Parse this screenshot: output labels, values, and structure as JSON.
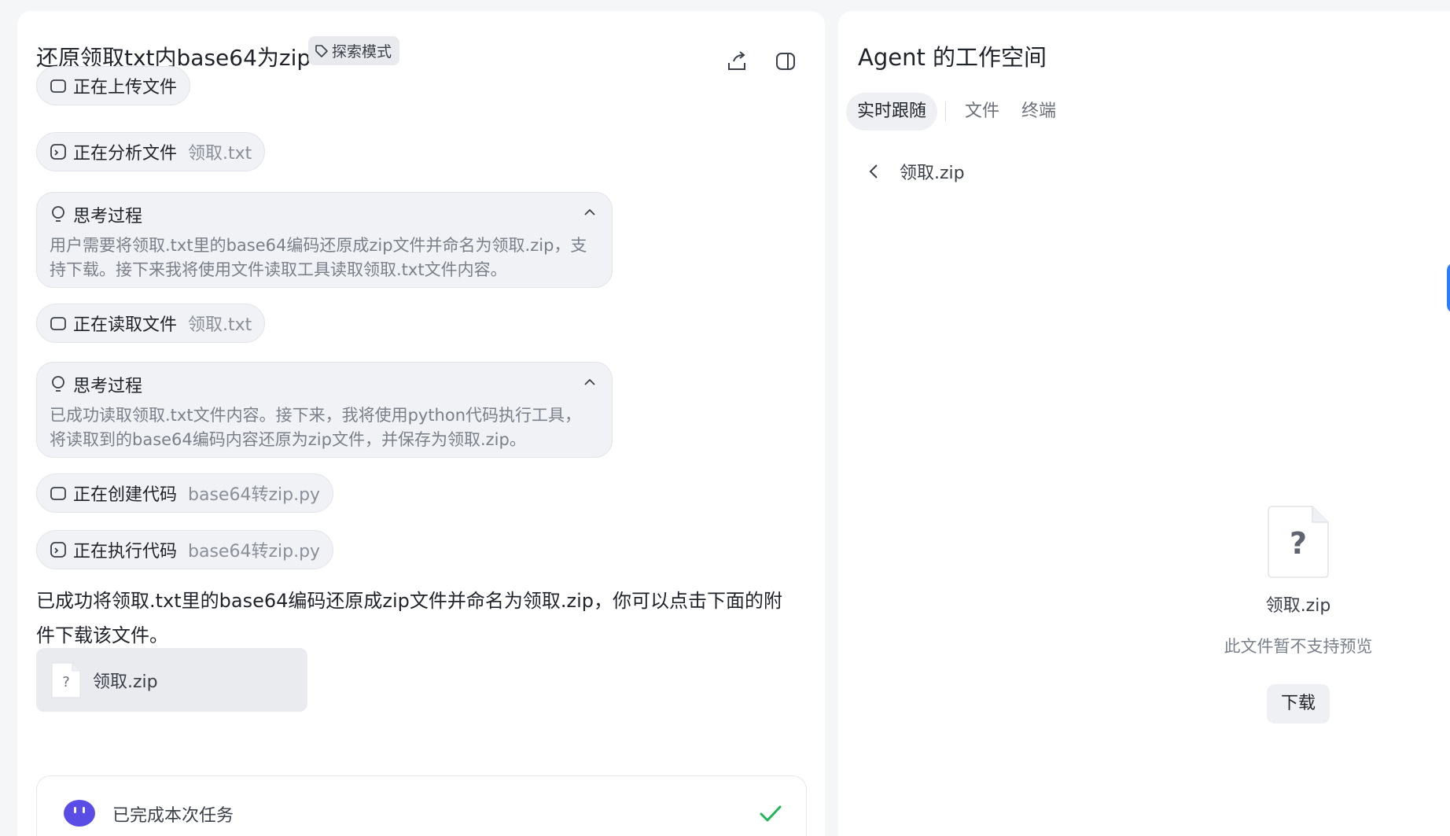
{
  "header": {
    "task_title": "还原领取txt内base64为zip",
    "mode_badge": "探索模式"
  },
  "steps": [
    {
      "action": "正在上传文件",
      "target": ""
    },
    {
      "action": "正在分析文件",
      "target": "领取.txt"
    },
    {
      "action": "正在读取文件",
      "target": "领取.txt"
    },
    {
      "action": "正在创建代码",
      "target": "base64转zip.py"
    },
    {
      "action": "正在执行代码",
      "target": "base64转zip.py"
    }
  ],
  "thoughts": [
    {
      "title": "思考过程",
      "text": "用户需要将领取.txt里的base64编码还原成zip文件并命名为领取.zip，支持下载。接下来我将使用文件读取工具读取领取.txt文件内容。"
    },
    {
      "title": "思考过程",
      "text": "已成功读取领取.txt文件内容。接下来，我将使用python代码执行工具，将读取到的base64编码内容还原为zip文件，并保存为领取.zip。"
    }
  ],
  "answer": "已成功将领取.txt里的base64编码还原成zip文件并命名为领取.zip，你可以点击下面的附件下载该文件。",
  "attachment": {
    "name": "领取.zip",
    "icon": "unknown-file-icon"
  },
  "status": {
    "text": "已完成本次任务"
  },
  "workspace": {
    "title": "Agent 的工作空间",
    "tabs": [
      "实时跟随",
      "文件",
      "终端"
    ],
    "active_tab": "实时跟随",
    "breadcrumb": "领取.zip",
    "preview_name": "领取.zip",
    "preview_note": "此文件暂不支持预览",
    "download_label": "下载"
  },
  "colors": {
    "accent": "#2b7bff",
    "success": "#22b55a",
    "avatar": "#5a4de6"
  }
}
